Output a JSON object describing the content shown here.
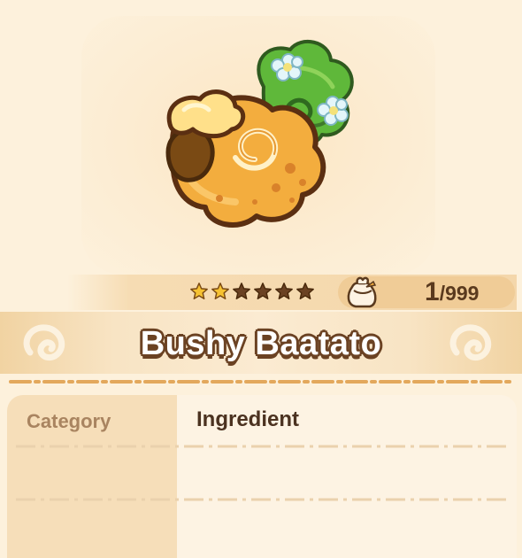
{
  "item": {
    "name": "Bushy Baatato",
    "icon": "bushy-baatato-item-art"
  },
  "rating": {
    "filled_stars": 2,
    "max_stars": 6,
    "filled_color": "#f6c232",
    "empty_color": "#6b4223"
  },
  "inventory": {
    "icon": "pouch-icon",
    "owned": "1",
    "separator": "/",
    "max": "999"
  },
  "details": {
    "rows": [
      {
        "label": "Category",
        "value": "Ingredient"
      }
    ]
  },
  "colors": {
    "background": "#fdf1dc",
    "title_outline": "#6b4223",
    "divider": "#e3a85c"
  }
}
